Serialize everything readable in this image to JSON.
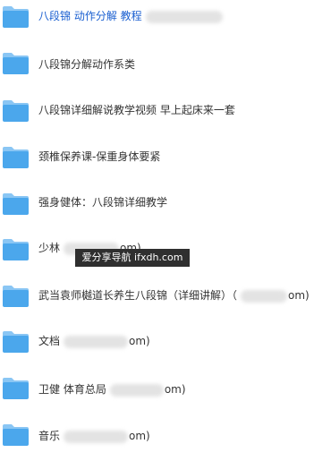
{
  "folders": [
    {
      "name": "八段锦 动作分解 教程",
      "tail": "",
      "highlighted": true
    },
    {
      "name": "八段锦分解动作系类",
      "tail": "",
      "highlighted": false
    },
    {
      "name": "八段锦详细解说教学视频 早上起床来一套",
      "tail": "",
      "highlighted": false
    },
    {
      "name": "颈椎保养课-保重身体要紧",
      "tail": "",
      "highlighted": false
    },
    {
      "name": "强身健体：八段锦详细教学",
      "tail": "",
      "highlighted": false
    },
    {
      "name": "少林",
      "tail": "om)",
      "highlighted": false
    },
    {
      "name": "武当袁师樾道长养生八段锦（详细讲解）（",
      "tail": "om)",
      "highlighted": false
    },
    {
      "name": "文档",
      "tail": "om)",
      "highlighted": false
    },
    {
      "name": "卫健 体育总局",
      "tail": "om)",
      "highlighted": false
    },
    {
      "name": "音乐",
      "tail": "om)",
      "highlighted": false
    }
  ],
  "watermark": "爱分享导航 ifxdh.com",
  "colors": {
    "folder_body": "#4ba7ec",
    "folder_tab": "#8ac6f4",
    "highlight_text": "#1a5fd0",
    "text": "#333333"
  }
}
